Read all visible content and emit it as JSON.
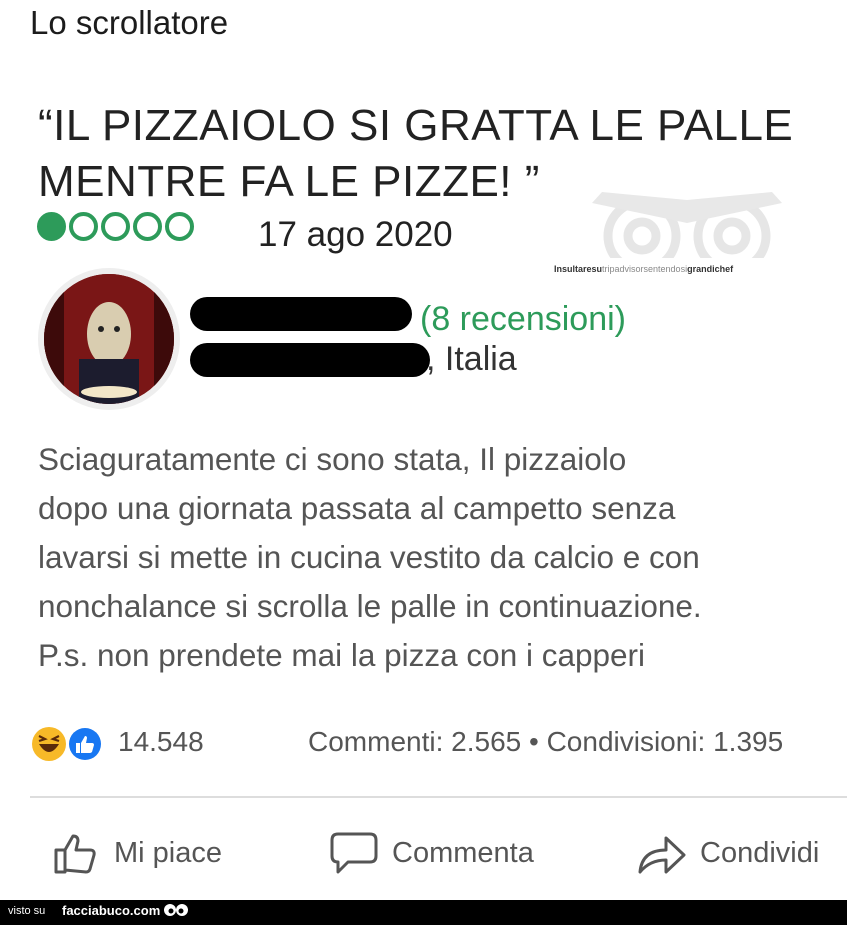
{
  "post": {
    "author": "Lo scrollatore"
  },
  "review": {
    "title_line1": "“IL PIZZAIOLO SI GRATTA LE PALLE",
    "title_line2": "MENTRE FA LE PIZZE! ”",
    "rating_value": 1,
    "rating_max": 5,
    "date": "17 ago 2020",
    "watermark_text_1": "Insultaresu",
    "watermark_text_2": "tripadvisor",
    "watermark_text_3": "sentendosi",
    "watermark_text_4": "grandichef",
    "reviewer_count": "(8 recensioni)",
    "reviewer_country": ", Italia",
    "body_lines": [
      "Sciaguratamente ci sono stata, Il pizzaiolo",
      "dopo una giornata passata al campetto senza",
      "lavarsi si mette in cucina vestito da calcio e con",
      "nonchalance si scrolla le palle in continuazione.",
      "P.s. non prendete mai la pizza con i capperi"
    ]
  },
  "stats": {
    "reactions": "14.548",
    "comments_shares": "Commenti: 2.565 • Condivisioni: 1.395"
  },
  "actions": {
    "like": "Mi piace",
    "comment": "Commenta",
    "share": "Condividi"
  },
  "footer": {
    "prefix": "visto su",
    "site": "facciabuco.com"
  },
  "colors": {
    "rating_green": "#2d9b5a",
    "like_blue": "#1877f2",
    "haha_yellow": "#f7b928"
  },
  "icons": [
    "haha-reaction-icon",
    "like-reaction-icon",
    "thumbs-up-icon",
    "comment-bubble-icon",
    "share-arrow-icon",
    "eyes-icon"
  ]
}
